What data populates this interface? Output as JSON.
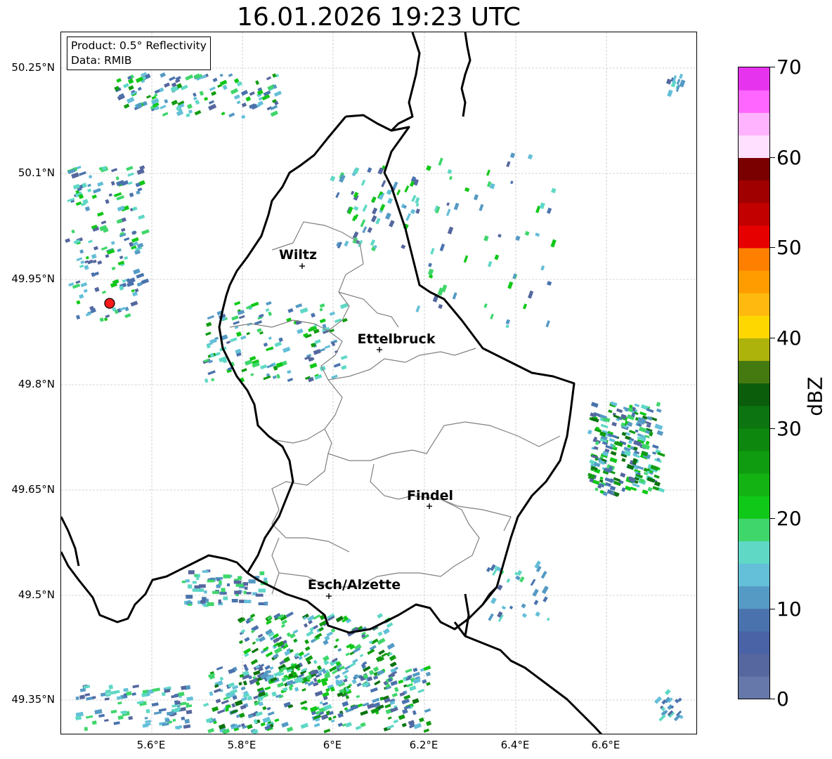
{
  "title": "16.01.2026 19:23 UTC",
  "info": {
    "product": "Product: 0.5° Reflectivity",
    "data": "Data: RMIB"
  },
  "axes": {
    "y_labels": [
      "50.25°N",
      "50.1°N",
      "49.95°N",
      "49.8°N",
      "49.65°N",
      "49.5°N",
      "49.35°N"
    ],
    "x_labels": [
      "5.6°E",
      "5.8°E",
      "6°E",
      "6.2°E",
      "6.4°E",
      "6.6°E"
    ]
  },
  "cities": [
    {
      "name": "Wiltz",
      "lon": 5.93,
      "lat": 49.97
    },
    {
      "name": "Ettelbruck",
      "lon": 6.1,
      "lat": 49.85
    },
    {
      "name": "Findel",
      "lon": 6.21,
      "lat": 49.63
    },
    {
      "name": "Esch/Alzette",
      "lon": 5.99,
      "lat": 49.5
    }
  ],
  "radar_site": {
    "lon": 5.51,
    "lat": 49.91
  },
  "colorbar": {
    "unit": "dBZ",
    "ticks": [
      "70",
      "60",
      "50",
      "40",
      "30",
      "20",
      "10",
      "0"
    ],
    "colors": [
      "#6678aa",
      "#55679e",
      "#4a63a6",
      "#4a73ad",
      "#559ac4",
      "#64bfd8",
      "#5fd8c6",
      "#3fd66b",
      "#10c818",
      "#12b312",
      "#109c10",
      "#0d870d",
      "#0c7410",
      "#0b5c0b",
      "#457a10",
      "#adb30a",
      "#ffd700",
      "#ffb90f",
      "#ff9d00",
      "#ff7f00",
      "#e60000",
      "#c20000",
      "#a00000",
      "#7a0000",
      "#ffe0ff",
      "#ffb3ff",
      "#ff66ff",
      "#e633ee"
    ]
  },
  "colors": {
    "border": "#000000",
    "cantons": "#808080",
    "radar": "#ff1a1a"
  }
}
